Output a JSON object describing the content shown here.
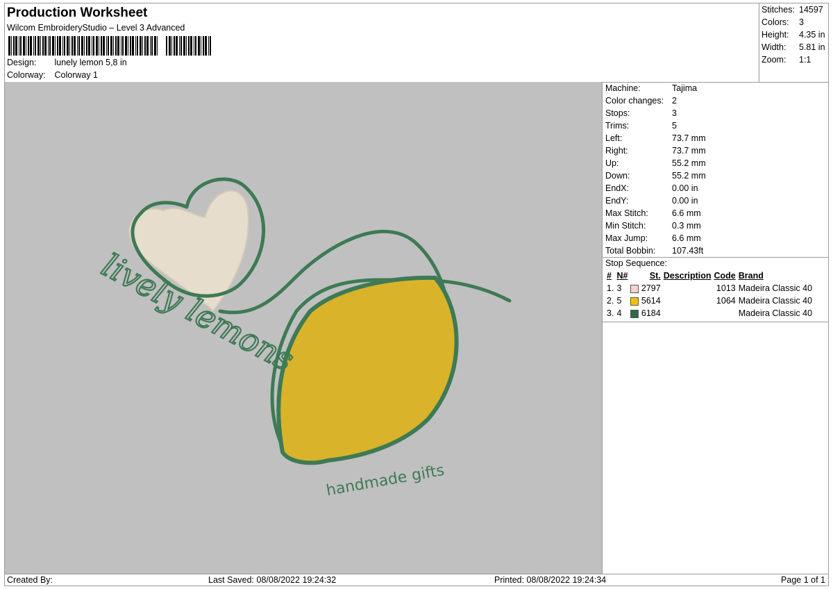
{
  "header": {
    "title": "Production Worksheet",
    "software": "Wilcom EmbroideryStudio – Level 3 Advanced",
    "design_label": "Design:",
    "design_value": "lunely lemon 5,8 in",
    "colorway_label": "Colorway:",
    "colorway_value": "Colorway 1"
  },
  "summary": [
    {
      "label": "Stitches:",
      "value": "14597"
    },
    {
      "label": "Colors:",
      "value": "3"
    },
    {
      "label": "Height:",
      "value": "4.35 in"
    },
    {
      "label": "Width:",
      "value": "5.81 in"
    },
    {
      "label": "Zoom:",
      "value": "1:1"
    }
  ],
  "machine_info": [
    {
      "label": "Machine:",
      "value": "Tajima"
    },
    {
      "label": "Color changes:",
      "value": "2"
    },
    {
      "label": "Stops:",
      "value": "3"
    },
    {
      "label": "Trims:",
      "value": "5"
    },
    {
      "label": "Left:",
      "value": "73.7 mm"
    },
    {
      "label": "Right:",
      "value": "73.7 mm"
    },
    {
      "label": "Up:",
      "value": "55.2 mm"
    },
    {
      "label": "Down:",
      "value": "55.2 mm"
    },
    {
      "label": "EndX:",
      "value": "0.00 in"
    },
    {
      "label": "EndY:",
      "value": "0.00 in"
    },
    {
      "label": "Max Stitch:",
      "value": "6.6 mm"
    },
    {
      "label": "Min Stitch:",
      "value": "0.3 mm"
    },
    {
      "label": "Max Jump:",
      "value": "6.6 mm"
    },
    {
      "label": "Total Bobbin:",
      "value": "107.43ft"
    }
  ],
  "stop_sequence": {
    "title": "Stop Sequence:",
    "columns": {
      "hash": "#",
      "n": "N#",
      "st": "St.",
      "desc": "Description",
      "code": "Code",
      "brand": "Brand"
    },
    "rows": [
      {
        "idx": "1.",
        "n": "3",
        "color": "#f2d5cf",
        "st": "2797",
        "code": "1013",
        "brand": "Madeira Classic 40"
      },
      {
        "idx": "2.",
        "n": "5",
        "color": "#f2c200",
        "st": "5614",
        "code": "1064",
        "brand": "Madeira Classic 40"
      },
      {
        "idx": "3.",
        "n": "4",
        "color": "#2f6b45",
        "st": "6184",
        "code": "",
        "brand": "Madeira Classic 40"
      }
    ]
  },
  "design_text": {
    "script": "lively lemons",
    "tagline": "handmade gifts"
  },
  "colors": {
    "canvas": "#c0c0c0",
    "heart": "#e6ddcc",
    "lemon": "#d9b32a",
    "outline": "#3e7a55"
  },
  "footer": {
    "created": "Created By:",
    "saved": "Last Saved: 08/08/2022 19:24:32",
    "printed": "Printed: 08/08/2022 19:24:34",
    "page": "Page 1 of 1"
  }
}
